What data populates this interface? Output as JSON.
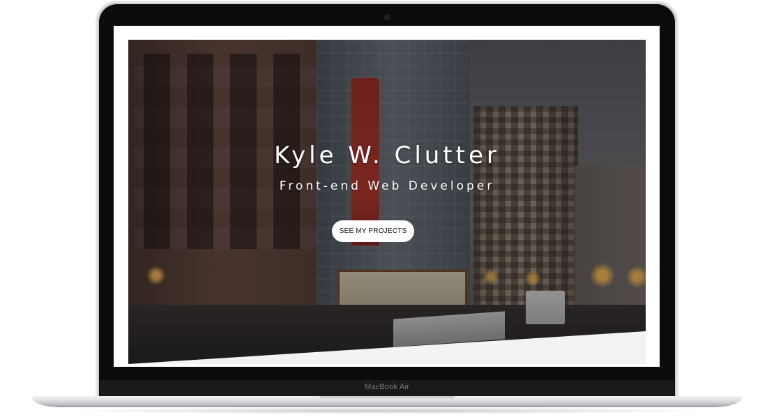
{
  "device": {
    "brand_label": "MacBook Air"
  },
  "hero": {
    "title": "Kyle W. Clutter",
    "subtitle": "Front-end Web Developer",
    "cta_label": "SEE MY PROJECTS"
  },
  "colors": {
    "overlay": "#000000",
    "cta_background": "#ffffff",
    "cta_text": "#111111",
    "angle_band": "#f3f3f3",
    "laptop_bezel": "#0b0b0b"
  }
}
